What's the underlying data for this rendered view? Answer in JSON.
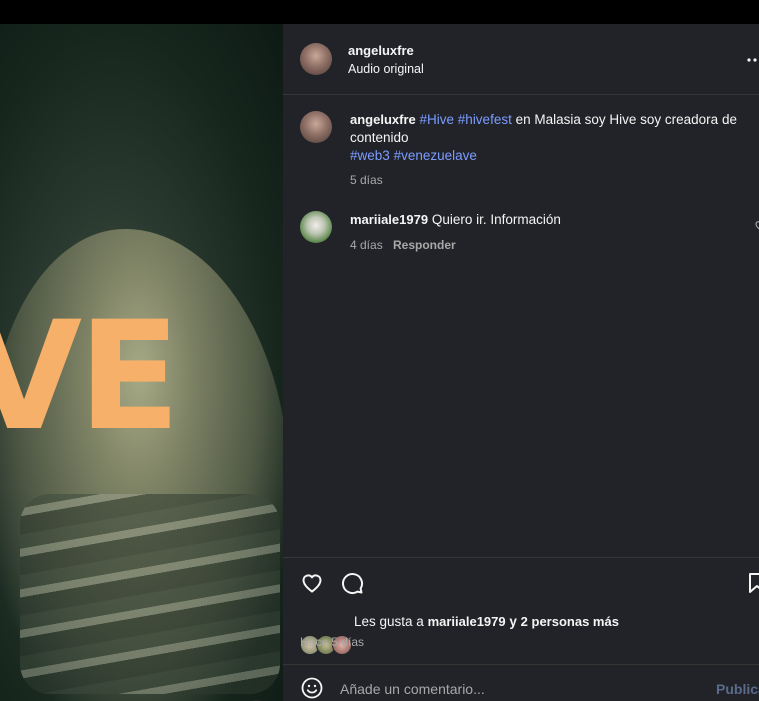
{
  "media": {
    "overlay_text": "VE"
  },
  "header": {
    "username": "angeluxfre",
    "subtitle": "Audio original",
    "more_icon": "more-horizontal-icon"
  },
  "caption": {
    "username": "angeluxfre",
    "tag1": "#Hive",
    "tag2": "#hivefest",
    "text": " en Malasia soy Hive soy creadora de contenido",
    "tag3": "#web3",
    "tag4": "#venezuelave",
    "time": "5 días"
  },
  "comments": [
    {
      "username": "mariiale1979",
      "text": "Quiero ir. Información",
      "time": "4 días",
      "reply": "Responder"
    }
  ],
  "likes": {
    "prefix": "Les gusta a ",
    "user": "mariiale1979",
    "connector": " y ",
    "others": "2 personas más",
    "time": "Hace 5 días"
  },
  "comment_input": {
    "placeholder": "Añade un comentario...",
    "publish": "Publicar"
  },
  "colors": {
    "panel_bg": "#212328",
    "hashtag": "#7c9cff",
    "overlay_text": "#f6b06a"
  }
}
